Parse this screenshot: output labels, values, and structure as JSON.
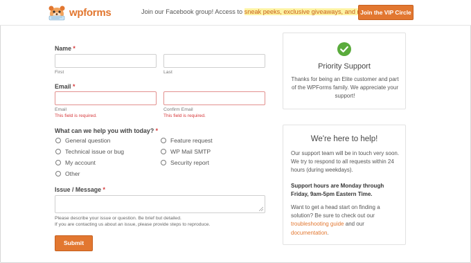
{
  "header": {
    "brand": "wpforms",
    "promo_prefix": "Join our Facebook group! Access to ",
    "promo_highlight": "sneak peeks, exclusive giveaways, and more",
    "promo_suffix": "!",
    "cta_label": "Join the VIP Circle"
  },
  "form": {
    "name_label": "Name",
    "name_first_sublabel": "First",
    "name_last_sublabel": "Last",
    "email_label": "Email",
    "email_sublabel": "Email",
    "confirm_email_sublabel": "Confirm Email",
    "required_marker": "*",
    "error_text": "This field is required.",
    "help_question_label": "What can we help you with today?",
    "options": [
      "General question",
      "Technical issue or bug",
      "My account",
      "Other",
      "Feature request",
      "WP Mail SMTP",
      "Security report"
    ],
    "message_label": "Issue / Message",
    "message_help_line1": "Please describe your issue or question. Be brief but detailed.",
    "message_help_line2": "If you are contacting us about an issue, please provide steps to reproduce.",
    "submit_label": "Submit"
  },
  "priority_card": {
    "icon": "check-circle-icon",
    "title": "Priority Support",
    "text": "Thanks for being an Elite customer and part of the WPForms family. We appreciate your support!"
  },
  "help_card": {
    "title": "We're here to help!",
    "para1": "Our support team will be in touch very soon. We try to respond to all requests within 24 hours (during weekdays).",
    "para2": "Support hours are Monday through Friday, 9am-5pm Eastern Time.",
    "para3_prefix": "Want to get a head start on finding a solution? Be sure to check out our ",
    "link1": "troubleshooting guide",
    "para3_mid": " and our ",
    "link2": "documentation",
    "para3_suffix": "."
  },
  "colors": {
    "accent": "#e27730",
    "success": "#5aab3c",
    "error": "#d63638",
    "highlight": "#fdf3a3"
  }
}
